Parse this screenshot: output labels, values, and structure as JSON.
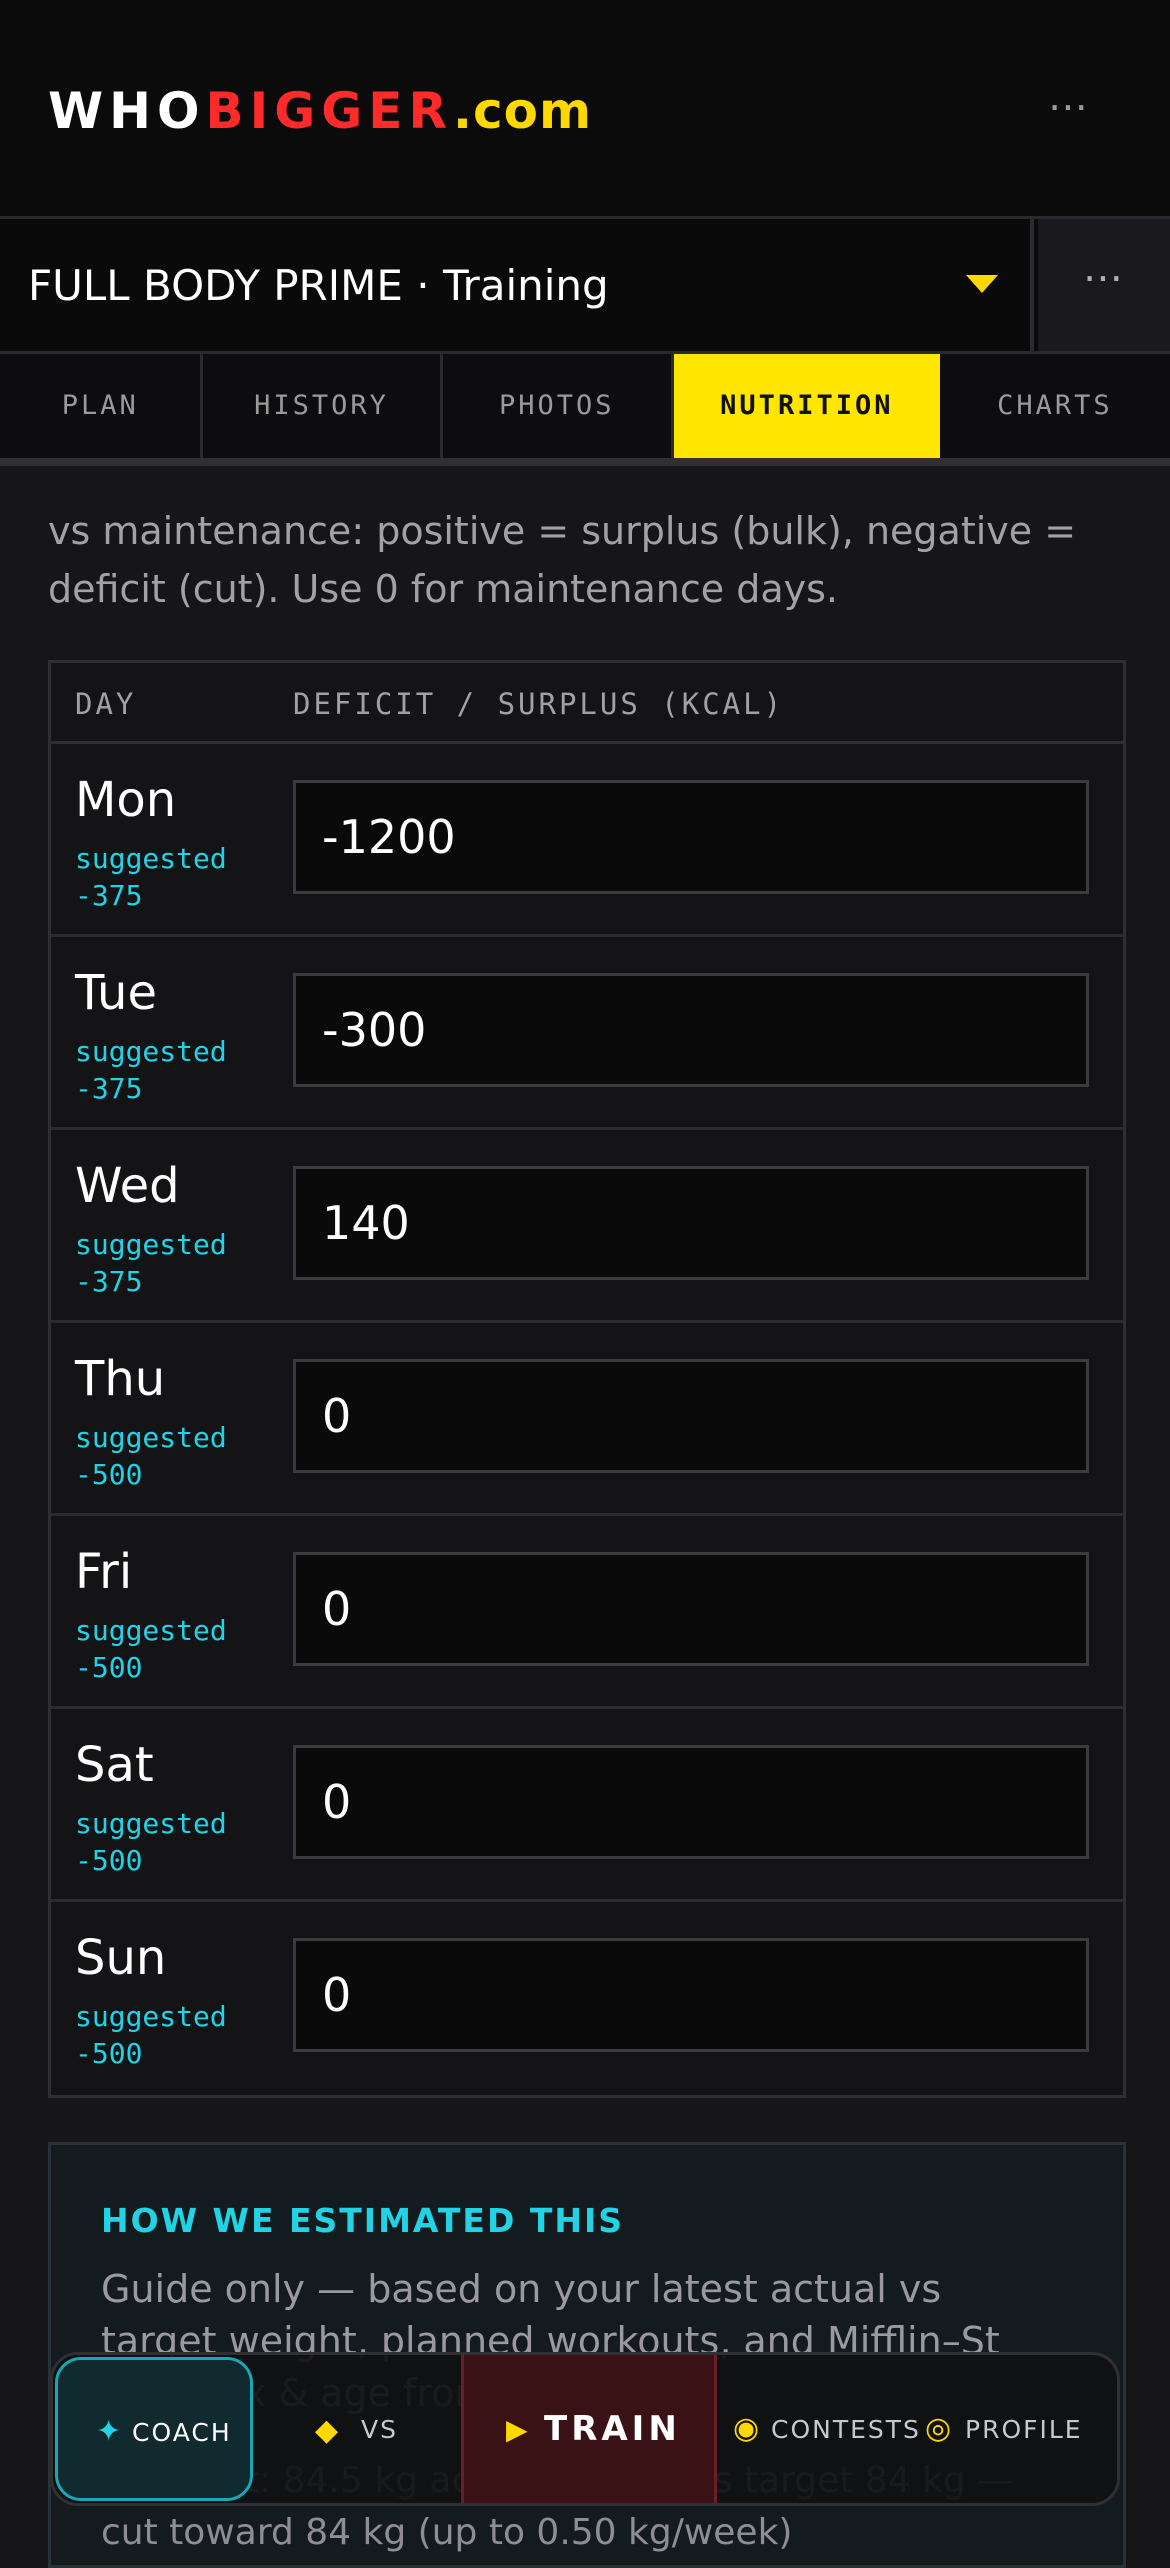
{
  "brand": {
    "part1": "WHO",
    "part2": "BIGGER",
    "part3": ".com"
  },
  "header": {
    "more": "⋯"
  },
  "plan": {
    "title": "FULL BODY PRIME · Training",
    "more": "⋯"
  },
  "tabs": [
    {
      "label": "PLAN",
      "active": false
    },
    {
      "label": "HISTORY",
      "active": false
    },
    {
      "label": "PHOTOS",
      "active": false
    },
    {
      "label": "NUTRITION",
      "active": true
    },
    {
      "label": "CHARTS",
      "active": false
    }
  ],
  "intro": "vs maintenance: positive = surplus (bulk), negative = deficit (cut). Use 0 for maintenance days.",
  "table": {
    "col_day": "DAY",
    "col_value": "DEFICIT / SURPLUS (KCAL)",
    "rows": [
      {
        "day": "Mon",
        "suggested": "suggested -375",
        "value": "-1200"
      },
      {
        "day": "Tue",
        "suggested": "suggested -375",
        "value": "-300"
      },
      {
        "day": "Wed",
        "suggested": "suggested -375",
        "value": "140"
      },
      {
        "day": "Thu",
        "suggested": "suggested -500",
        "value": "0"
      },
      {
        "day": "Fri",
        "suggested": "suggested -500",
        "value": "0"
      },
      {
        "day": "Sat",
        "suggested": "suggested -500",
        "value": "0"
      },
      {
        "day": "Sun",
        "suggested": "suggested -500",
        "value": "0"
      }
    ]
  },
  "estimate": {
    "title": "HOW WE ESTIMATED THIS",
    "text": "Guide only — based on your latest actual vs target weight, planned workouts, and Mifflin–St Jeor (sex & age from profile).",
    "bullet": "•  Weight: 84.5 kg actual (latest) vs target 84 kg — cut toward 84 kg (up to 0.50 kg/week)"
  },
  "nav": {
    "coach": {
      "icon": "✦",
      "label": "COACH"
    },
    "vs": {
      "icon": "◆",
      "label": "VS"
    },
    "train": {
      "icon": "▶",
      "label": "TRAIN"
    },
    "contests": {
      "icon": "◉",
      "label": "CONTESTS"
    },
    "profile": {
      "icon": "◎",
      "label": "PROFILE"
    }
  },
  "colors": {
    "accent": "#ffe600",
    "brand_red": "#ff2b2b",
    "cyan": "#22d3e6",
    "bg": "#16161a"
  }
}
